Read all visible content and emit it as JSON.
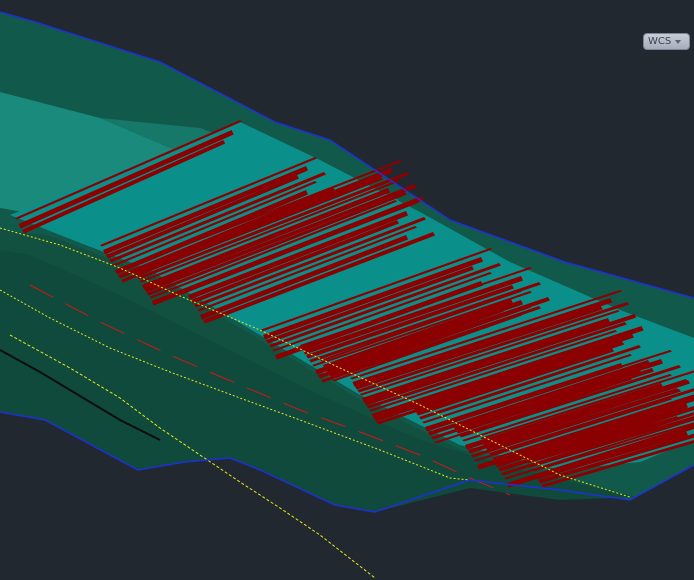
{
  "viewport": {
    "background_color": "#212830",
    "ucs_badge": {
      "label": "WCS",
      "icon": "chevron-down-icon"
    }
  },
  "scene": {
    "colors": {
      "surface_dark": "#0f4a3c",
      "surface_mid": "#11594a",
      "surface_light": "#1a8a7c",
      "cut_face": "#0b8f8a",
      "hatch_red": "#8b0000",
      "boundary_blue": "#1f2fd6",
      "line_yellow": "#e8e81a",
      "line_red": "#d01818",
      "line_black": "#0a0f0c"
    }
  }
}
